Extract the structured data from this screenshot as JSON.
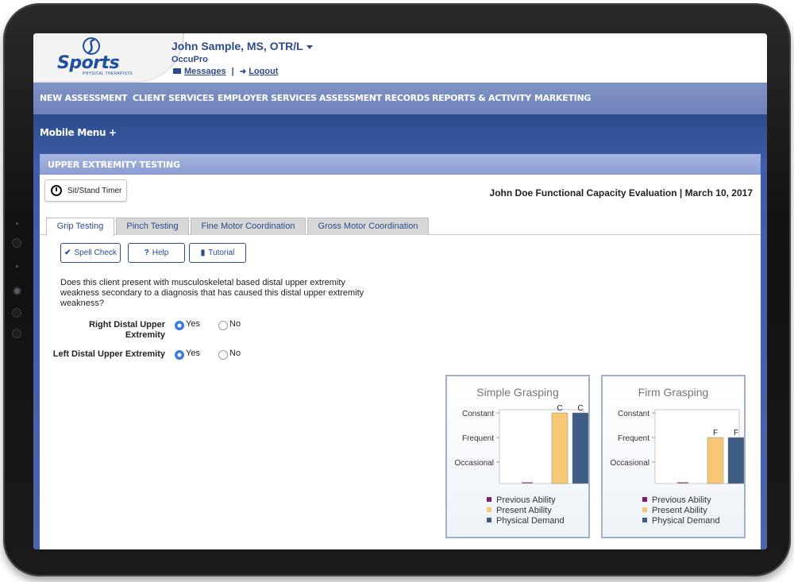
{
  "header": {
    "logo_text": "Sports",
    "logo_subtext": "PHYSICAL THERAPISTS",
    "user_name": "John Sample, MS, OTR/L",
    "organization": "OccuPro",
    "messages_label": "Messages",
    "separator": "|",
    "logout_label": "Logout"
  },
  "nav": {
    "items": [
      "NEW ASSESSMENT",
      "CLIENT SERVICES",
      "EMPLOYER SERVICES",
      "ASSESSMENT RECORDS",
      "REPORTS & ACTIVITY",
      "MARKETING"
    ]
  },
  "mobile_menu": "Mobile Menu +",
  "panel": {
    "title": "UPPER EXTREMITY TESTING",
    "timer_label": "Sit/Stand Timer",
    "evaluation_title": "John Doe Functional Capacity Evaluation | March 10, 2017"
  },
  "tabs": [
    "Grip Testing",
    "Pinch Testing",
    "Fine Motor Coordination",
    "Gross Motor Coordination"
  ],
  "active_tab": "Grip Testing",
  "toolbar": {
    "spell_check": "Spell Check",
    "help": "Help",
    "tutorial": "Tutorial"
  },
  "question": "Does this client present with musculoskeletal based distal upper extremity weakness secondary to a diagnosis that has caused this distal upper extremity weakness?",
  "radios": [
    {
      "label": "Right Distal Upper Extremity",
      "yes": "Yes",
      "no": "No",
      "selected": "Yes"
    },
    {
      "label": "Left Distal Upper Extremity",
      "yes": "Yes",
      "no": "No",
      "selected": "Yes"
    }
  ],
  "colors": {
    "previous": "#7b1f6e",
    "present": "#f7c873",
    "demand": "#3f5c82",
    "nav": "#7688bf",
    "brand": "#2c4a8c"
  },
  "chart_data": [
    {
      "type": "bar",
      "title": "Simple Grasping",
      "categories": [
        "Occasional",
        "Frequent",
        "Constant"
      ],
      "series": [
        {
          "name": "Previous Ability",
          "value": null,
          "label": ""
        },
        {
          "name": "Present Ability",
          "value": "Constant",
          "label": "C"
        },
        {
          "name": "Physical Demand",
          "value": "Constant",
          "label": "C"
        }
      ],
      "legend": "bottom"
    },
    {
      "type": "bar",
      "title": "Firm Grasping",
      "categories": [
        "Occasional",
        "Frequent",
        "Constant"
      ],
      "series": [
        {
          "name": "Previous Ability",
          "value": null,
          "label": ""
        },
        {
          "name": "Present Ability",
          "value": "Frequent",
          "label": "F"
        },
        {
          "name": "Physical Demand",
          "value": "Frequent",
          "label": "F"
        }
      ],
      "legend": "bottom"
    }
  ]
}
